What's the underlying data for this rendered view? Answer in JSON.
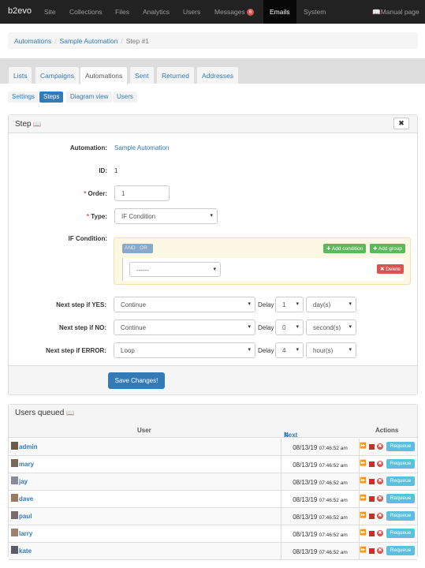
{
  "nav": {
    "brand": "b2evo",
    "items": [
      "Site",
      "Collections",
      "Files",
      "Analytics",
      "Users",
      "Messages",
      "Emails",
      "System"
    ],
    "messages_badge": "6",
    "manual": "Manual page"
  },
  "breadcrumb": {
    "items": [
      "Automations",
      "Sample Automation"
    ],
    "current": "Step #1"
  },
  "tabs": [
    "Lists",
    "Campaigns",
    "Automations",
    "Sent",
    "Returned",
    "Addresses"
  ],
  "subtabs": [
    "Settings",
    "Steps",
    "Diagram view",
    "Users"
  ],
  "step_panel": {
    "title": "Step",
    "automation_label": "Automation:",
    "automation_value": "Sample Automation",
    "id_label": "ID:",
    "id_value": "1",
    "order_label": "Order:",
    "order_value": "1",
    "type_label": "Type:",
    "type_value": "IF Condition",
    "ifcond_label": "IF Condition:",
    "and": "AND",
    "or": "OR",
    "add_condition": "Add condition",
    "add_group": "Add group",
    "rule_select": "------",
    "delete": "Delete",
    "yes_label": "Next step if YES:",
    "yes_step": "Continue",
    "yes_delay": "1",
    "yes_unit": "day(s)",
    "no_label": "Next step if NO:",
    "no_step": "Continue",
    "no_delay": "0",
    "no_unit": "second(s)",
    "err_label": "Next step if ERROR:",
    "err_step": "Loop",
    "err_delay": "4",
    "err_unit": "hour(s)",
    "delay_label": "Delay",
    "save": "Save Changes!"
  },
  "users_panel": {
    "title": "Users queued",
    "col_user": "User",
    "col_next": "Next execution time",
    "col_actions": "Actions",
    "requeue": "Requeue",
    "rows": [
      {
        "user": "admin",
        "date": "08/13/19",
        "time": "07:46:52 am"
      },
      {
        "user": "mary",
        "date": "08/13/19",
        "time": "07:46:52 am"
      },
      {
        "user": "jay",
        "date": "08/13/19",
        "time": "07:46:52 am"
      },
      {
        "user": "dave",
        "date": "08/13/19",
        "time": "07:46:52 am"
      },
      {
        "user": "paul",
        "date": "08/13/19",
        "time": "07:46:52 am"
      },
      {
        "user": "larry",
        "date": "08/13/19",
        "time": "07:46:52 am"
      },
      {
        "user": "kate",
        "date": "08/13/19",
        "time": "07:46:52 am"
      }
    ]
  },
  "icons": {
    "manual": "book-icon",
    "close": "close-icon",
    "forward": "fast-forward-icon",
    "stop": "stop-icon",
    "remove": "remove-icon"
  }
}
